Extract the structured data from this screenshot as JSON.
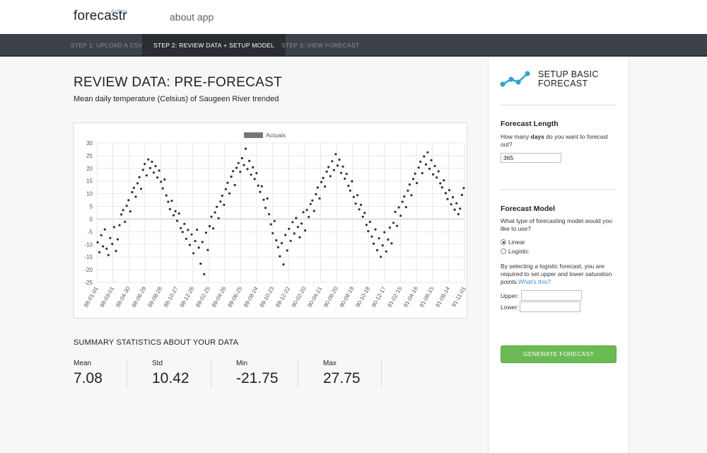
{
  "brand": {
    "name": "forecastr",
    "badge": "ALPHA"
  },
  "nav": {
    "about": "about app"
  },
  "steps": [
    {
      "label": "STEP 1: UPLOAD A CSV"
    },
    {
      "label": "STEP 2: REVIEW DATA + SETUP MODEL"
    },
    {
      "label": "STEP 3: VIEW FORECAST"
    }
  ],
  "main": {
    "title": "REVIEW DATA: PRE-FORECAST",
    "subtitle": "Mean daily temperature (Celsius) of Saugeen River trended"
  },
  "chart_data": {
    "type": "scatter",
    "legend": [
      "Actuals"
    ],
    "legend_position": "top-center",
    "grid": true,
    "ylim": [
      -25,
      30
    ],
    "y_ticks": [
      30,
      25,
      20,
      15,
      10,
      5,
      0,
      -5,
      -10,
      -15,
      -20,
      -25
    ],
    "x_ticks": [
      "88-01-01",
      "88-03-01",
      "88-04-30",
      "88-06-29",
      "88-08-28",
      "88-10-27",
      "88-12-26",
      "89-02-25",
      "89-04-26",
      "89-06-25",
      "89-08-24",
      "89-10-23",
      "89-12-22",
      "90-02-20",
      "90-04-21",
      "90-06-20",
      "90-08-19",
      "90-10-18",
      "90-12-17",
      "91-02-15",
      "91-04-16",
      "91-06-15",
      "91-08-14",
      "91-11-01"
    ],
    "x_range": [
      "1988-01-01",
      "1991-11-29"
    ],
    "series": [
      {
        "name": "Actuals",
        "color": "#333333",
        "points": [
          [
            "1988-01-04",
            -9.2
          ],
          [
            "1988-01-11",
            -13.1
          ],
          [
            "1988-01-18",
            -6.4
          ],
          [
            "1988-01-25",
            -10.8
          ],
          [
            "1988-02-01",
            -4.1
          ],
          [
            "1988-02-08",
            -11.7
          ],
          [
            "1988-02-15",
            -14.2
          ],
          [
            "1988-02-22",
            -7.5
          ],
          [
            "1988-03-01",
            -9.8
          ],
          [
            "1988-03-08",
            -3.2
          ],
          [
            "1988-03-15",
            -12.6
          ],
          [
            "1988-03-22",
            -8.0
          ],
          [
            "1988-03-29",
            -2.4
          ],
          [
            "1988-04-05",
            1.8
          ],
          [
            "1988-04-12",
            3.5
          ],
          [
            "1988-04-19",
            -1.1
          ],
          [
            "1988-04-26",
            5.2
          ],
          [
            "1988-05-03",
            7.4
          ],
          [
            "1988-05-10",
            3.0
          ],
          [
            "1988-05-17",
            10.6
          ],
          [
            "1988-05-24",
            12.3
          ],
          [
            "1988-05-31",
            8.8
          ],
          [
            "1988-06-07",
            14.1
          ],
          [
            "1988-06-14",
            16.5
          ],
          [
            "1988-06-21",
            11.9
          ],
          [
            "1988-06-28",
            19.4
          ],
          [
            "1988-07-05",
            21.7
          ],
          [
            "1988-07-12",
            17.2
          ],
          [
            "1988-07-19",
            23.5
          ],
          [
            "1988-07-26",
            20.1
          ],
          [
            "1988-08-02",
            22.6
          ],
          [
            "1988-08-09",
            18.3
          ],
          [
            "1988-08-16",
            20.9
          ],
          [
            "1988-08-23",
            16.4
          ],
          [
            "1988-08-30",
            19.1
          ],
          [
            "1988-09-06",
            14.7
          ],
          [
            "1988-09-13",
            12.1
          ],
          [
            "1988-09-20",
            15.6
          ],
          [
            "1988-09-27",
            9.3
          ],
          [
            "1988-10-04",
            6.8
          ],
          [
            "1988-10-11",
            3.9
          ],
          [
            "1988-10-18",
            7.2
          ],
          [
            "1988-10-25",
            1.5
          ],
          [
            "1988-11-01",
            3.1
          ],
          [
            "1988-11-08",
            -0.7
          ],
          [
            "1988-11-15",
            2.2
          ],
          [
            "1988-11-22",
            -3.6
          ],
          [
            "1988-11-29",
            -5.1
          ],
          [
            "1988-12-06",
            -1.9
          ],
          [
            "1988-12-13",
            -7.8
          ],
          [
            "1988-12-20",
            -4.3
          ],
          [
            "1988-12-27",
            -10.2
          ],
          [
            "1989-01-03",
            -6.1
          ],
          [
            "1989-01-10",
            -13.5
          ],
          [
            "1989-01-17",
            -8.7
          ],
          [
            "1989-01-24",
            -4.2
          ],
          [
            "1989-01-31",
            -11.3
          ],
          [
            "1989-02-07",
            -17.6
          ],
          [
            "1989-02-14",
            -9.1
          ],
          [
            "1989-02-21",
            -21.75
          ],
          [
            "1989-02-28",
            -5.4
          ],
          [
            "1989-03-07",
            -12.2
          ],
          [
            "1989-03-14",
            -2.8
          ],
          [
            "1989-03-21",
            0.9
          ],
          [
            "1989-03-28",
            -3.7
          ],
          [
            "1989-04-04",
            2.6
          ],
          [
            "1989-04-11",
            4.8
          ],
          [
            "1989-04-18",
            0.3
          ],
          [
            "1989-04-25",
            6.9
          ],
          [
            "1989-05-02",
            9.2
          ],
          [
            "1989-05-09",
            5.6
          ],
          [
            "1989-05-16",
            11.8
          ],
          [
            "1989-05-23",
            14.3
          ],
          [
            "1989-05-30",
            10.1
          ],
          [
            "1989-06-06",
            16.7
          ],
          [
            "1989-06-13",
            18.9
          ],
          [
            "1989-06-20",
            13.4
          ],
          [
            "1989-06-27",
            20.2
          ],
          [
            "1989-07-04",
            22.1
          ],
          [
            "1989-07-11",
            18.6
          ],
          [
            "1989-07-18",
            24.0
          ],
          [
            "1989-07-25",
            21.3
          ],
          [
            "1989-08-01",
            27.75
          ],
          [
            "1989-08-08",
            19.7
          ],
          [
            "1989-08-15",
            22.9
          ],
          [
            "1989-08-22",
            17.5
          ],
          [
            "1989-08-29",
            20.4
          ],
          [
            "1989-09-05",
            15.8
          ],
          [
            "1989-09-12",
            18.1
          ],
          [
            "1989-09-19",
            13.2
          ],
          [
            "1989-09-26",
            10.7
          ],
          [
            "1989-10-03",
            12.9
          ],
          [
            "1989-10-10",
            7.6
          ],
          [
            "1989-10-17",
            4.4
          ],
          [
            "1989-10-24",
            8.1
          ],
          [
            "1989-10-31",
            1.9
          ],
          [
            "1989-11-07",
            -2.1
          ],
          [
            "1989-11-14",
            -5.6
          ],
          [
            "1989-11-21",
            -0.8
          ],
          [
            "1989-11-28",
            -8.4
          ],
          [
            "1989-12-05",
            -11.1
          ],
          [
            "1989-12-12",
            -14.7
          ],
          [
            "1989-12-19",
            -9.5
          ],
          [
            "1989-12-26",
            -17.9
          ],
          [
            "1990-01-02",
            -6.3
          ],
          [
            "1990-01-09",
            -12.4
          ],
          [
            "1990-01-16",
            -3.9
          ],
          [
            "1990-01-23",
            -8.6
          ],
          [
            "1990-01-30",
            -1.2
          ],
          [
            "1990-02-06",
            -5.7
          ],
          [
            "1990-02-13",
            0.4
          ],
          [
            "1990-02-20",
            -3.1
          ],
          [
            "1990-02-27",
            -7.2
          ],
          [
            "1990-03-06",
            -1.8
          ],
          [
            "1990-03-13",
            2.7
          ],
          [
            "1990-03-20",
            -4.5
          ],
          [
            "1990-03-27",
            3.6
          ],
          [
            "1990-04-03",
            0.8
          ],
          [
            "1990-04-10",
            5.9
          ],
          [
            "1990-04-17",
            7.3
          ],
          [
            "1990-04-24",
            3.2
          ],
          [
            "1990-05-01",
            9.8
          ],
          [
            "1990-05-08",
            12.4
          ],
          [
            "1990-05-15",
            8.1
          ],
          [
            "1990-05-22",
            14.6
          ],
          [
            "1990-05-29",
            16.2
          ],
          [
            "1990-06-05",
            12.8
          ],
          [
            "1990-06-12",
            18.7
          ],
          [
            "1990-06-19",
            20.5
          ],
          [
            "1990-06-26",
            16.9
          ],
          [
            "1990-07-03",
            22.8
          ],
          [
            "1990-07-10",
            19.3
          ],
          [
            "1990-07-17",
            25.6
          ],
          [
            "1990-07-24",
            21.1
          ],
          [
            "1990-07-31",
            23.4
          ],
          [
            "1990-08-07",
            18.2
          ],
          [
            "1990-08-14",
            20.7
          ],
          [
            "1990-08-21",
            15.9
          ],
          [
            "1990-08-28",
            17.8
          ],
          [
            "1990-09-04",
            13.1
          ],
          [
            "1990-09-11",
            11.2
          ],
          [
            "1990-09-18",
            14.9
          ],
          [
            "1990-09-25",
            8.7
          ],
          [
            "1990-10-02",
            6.1
          ],
          [
            "1990-10-09",
            9.4
          ],
          [
            "1990-10-16",
            3.8
          ],
          [
            "1990-10-23",
            5.6
          ],
          [
            "1990-10-30",
            0.9
          ],
          [
            "1990-11-06",
            2.4
          ],
          [
            "1990-11-13",
            -2.3
          ],
          [
            "1990-11-20",
            -4.8
          ],
          [
            "1990-11-27",
            -1.1
          ],
          [
            "1990-12-04",
            -6.9
          ],
          [
            "1990-12-11",
            -9.7
          ],
          [
            "1990-12-18",
            -4.1
          ],
          [
            "1990-12-25",
            -12.3
          ],
          [
            "1991-01-01",
            -7.6
          ],
          [
            "1991-01-08",
            -14.9
          ],
          [
            "1991-01-15",
            -10.4
          ],
          [
            "1991-01-22",
            -5.2
          ],
          [
            "1991-01-29",
            -12.8
          ],
          [
            "1991-02-05",
            -8.1
          ],
          [
            "1991-02-12",
            -3.4
          ],
          [
            "1991-02-19",
            -9.6
          ],
          [
            "1991-02-26",
            -1.5
          ],
          [
            "1991-03-05",
            2.8
          ],
          [
            "1991-03-12",
            -2.7
          ],
          [
            "1991-03-19",
            4.6
          ],
          [
            "1991-03-26",
            1.3
          ],
          [
            "1991-04-02",
            6.8
          ],
          [
            "1991-04-09",
            8.9
          ],
          [
            "1991-04-16",
            4.7
          ],
          [
            "1991-04-23",
            11.2
          ],
          [
            "1991-04-30",
            13.6
          ],
          [
            "1991-05-07",
            9.4
          ],
          [
            "1991-05-14",
            15.8
          ],
          [
            "1991-05-21",
            17.9
          ],
          [
            "1991-05-28",
            14.2
          ],
          [
            "1991-06-04",
            20.3
          ],
          [
            "1991-06-11",
            22.6
          ],
          [
            "1991-06-18",
            18.1
          ],
          [
            "1991-06-25",
            24.7
          ],
          [
            "1991-07-02",
            21.5
          ],
          [
            "1991-07-09",
            26.3
          ],
          [
            "1991-07-16",
            19.8
          ],
          [
            "1991-07-23",
            23.2
          ],
          [
            "1991-07-30",
            17.6
          ],
          [
            "1991-08-06",
            20.9
          ],
          [
            "1991-08-13",
            16.4
          ],
          [
            "1991-08-20",
            18.8
          ],
          [
            "1991-08-27",
            14.1
          ],
          [
            "1991-09-03",
            12.5
          ],
          [
            "1991-09-10",
            15.3
          ],
          [
            "1991-09-17",
            10.2
          ],
          [
            "1991-09-24",
            7.9
          ],
          [
            "1991-10-01",
            11.4
          ],
          [
            "1991-10-08",
            5.8
          ],
          [
            "1991-10-15",
            8.6
          ],
          [
            "1991-10-22",
            3.7
          ],
          [
            "1991-10-29",
            6.2
          ],
          [
            "1991-11-05",
            1.9
          ],
          [
            "1991-11-12",
            4.1
          ],
          [
            "1991-11-19",
            9.5
          ],
          [
            "1991-11-26",
            12.2
          ]
        ]
      }
    ]
  },
  "stats": {
    "title": "SUMMARY STATISTICS ABOUT YOUR DATA",
    "items": [
      {
        "label": "Mean",
        "value": "7.08"
      },
      {
        "label": "Std",
        "value": "10.42"
      },
      {
        "label": "Min",
        "value": "-21.75"
      },
      {
        "label": "Max",
        "value": "27.75"
      }
    ]
  },
  "sidebar": {
    "heading": "SETUP BASIC FORECAST",
    "length": {
      "title": "Forecast Length",
      "desc_pre": "How many ",
      "desc_bold": "days",
      "desc_post": " do you want to forecast out?",
      "value": "365"
    },
    "model": {
      "title": "Forecast Model",
      "desc": "What type of forecasting model would you like to use?",
      "options": [
        {
          "label": "Linear",
          "selected": true
        },
        {
          "label": "Logistic",
          "selected": false
        }
      ],
      "note": "By selecting a logistic forecast, you are required to set upper and lower saturation points.",
      "note_link": "What's this?",
      "upper_label": "Upper:",
      "lower_label": "Lower:",
      "upper_value": "",
      "lower_value": ""
    },
    "generate_label": "GENERATE FORECAST"
  },
  "colors": {
    "accent": "#3b8fd9",
    "icon": "#29a3d9",
    "button": "#6cba53",
    "steps_bg": "#3c4249"
  }
}
